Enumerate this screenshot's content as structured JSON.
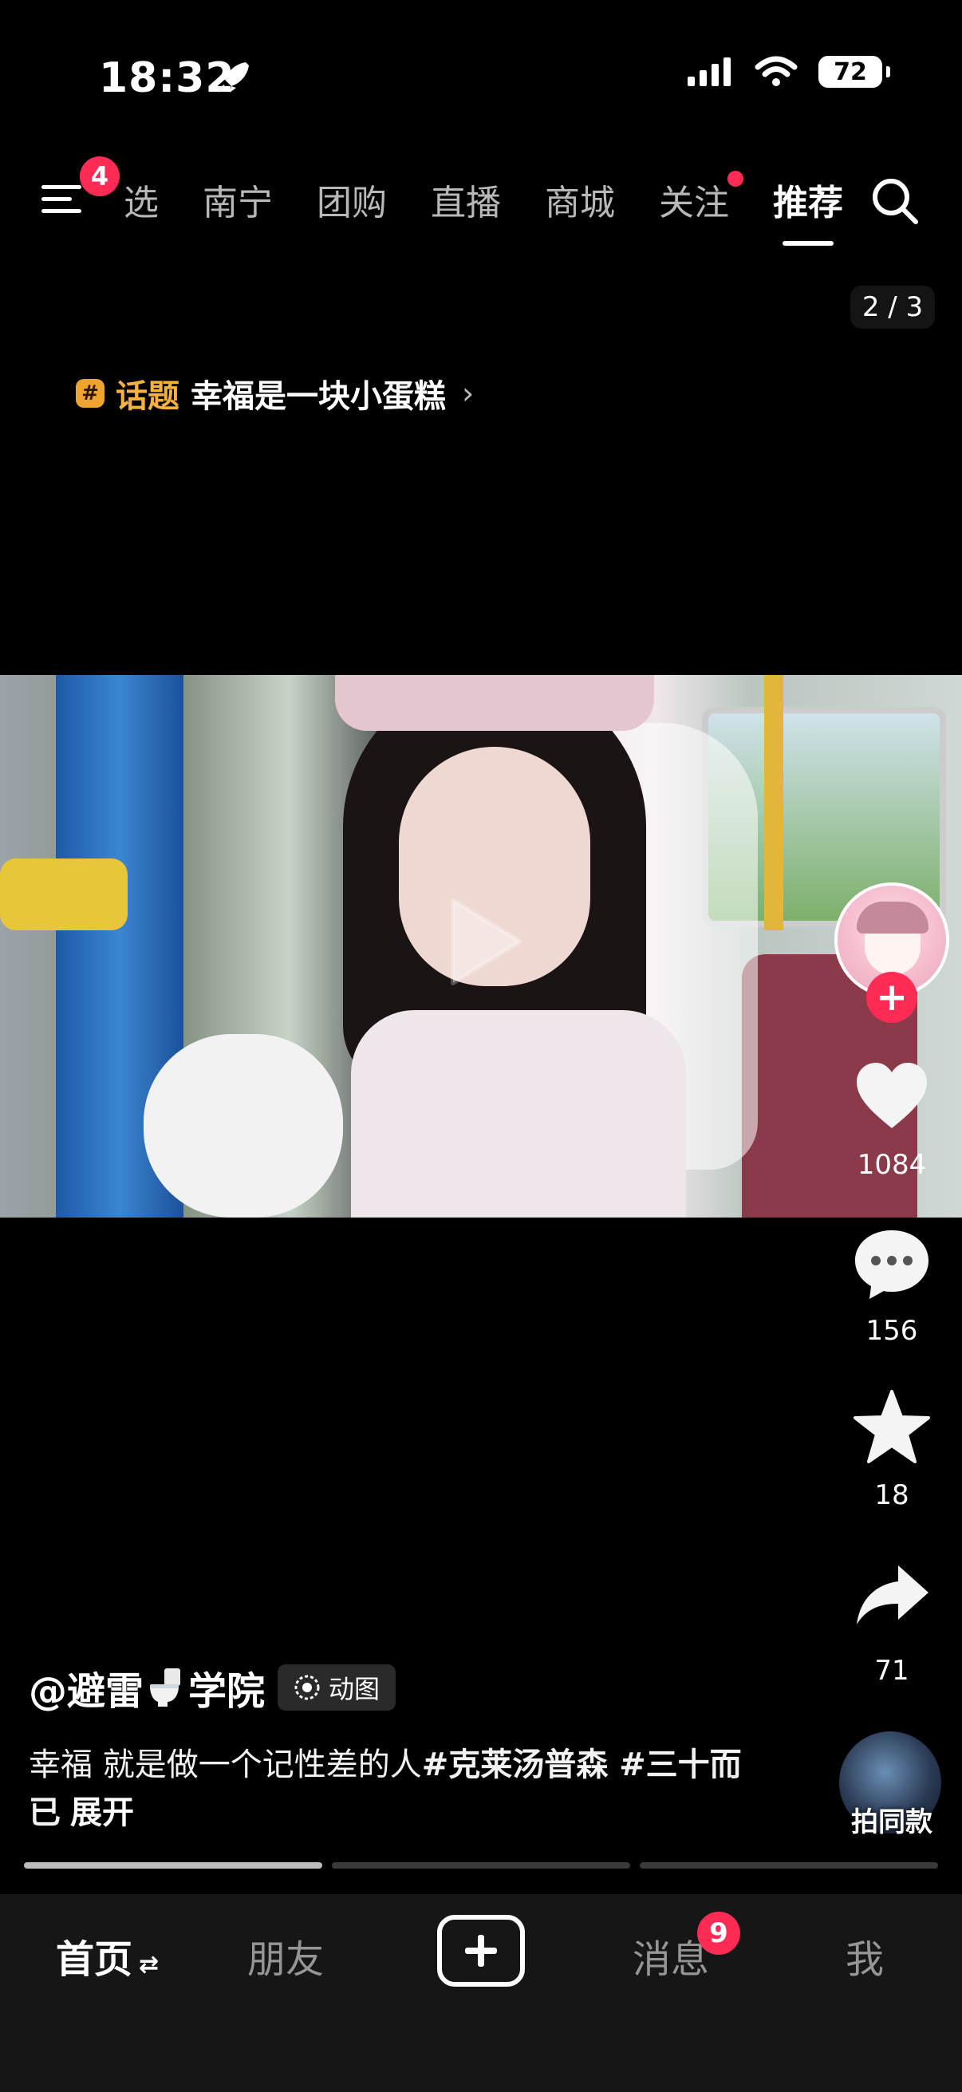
{
  "status_bar": {
    "time": "18:32",
    "battery": "72",
    "icons": [
      "rocket-icon",
      "signal-icon",
      "wifi-icon",
      "battery-icon"
    ]
  },
  "top_nav": {
    "menu_badge": "4",
    "tabs": [
      {
        "label": "选",
        "active": false
      },
      {
        "label": "南宁",
        "active": false
      },
      {
        "label": "团购",
        "active": false
      },
      {
        "label": "直播",
        "active": false
      },
      {
        "label": "商城",
        "active": false
      },
      {
        "label": "关注",
        "active": false,
        "dot": true
      },
      {
        "label": "推荐",
        "active": true
      }
    ]
  },
  "pager": "2 / 3",
  "topic": {
    "icon": "#",
    "label": "话题",
    "name": "幸福是一块小蛋糕"
  },
  "rail": {
    "likes": "1084",
    "comments": "156",
    "favorites": "18",
    "shares": "71",
    "same_style": "拍同款"
  },
  "post": {
    "author_prefix": "@避雷",
    "author_suffix": "学院",
    "badge": "动图",
    "caption_text": "幸福 就是做一个记性差的人",
    "hashtag1": "#克莱汤普森",
    "hashtag2": " #三十而已",
    "expand": "展开"
  },
  "progress": {
    "segments": 3,
    "current_fill": 1.0,
    "current_index": 0
  },
  "bottom_nav": {
    "home": "首页",
    "friends": "朋友",
    "messages": "消息",
    "messages_badge": "9",
    "me": "我"
  },
  "colors": {
    "accent": "#fe2c55",
    "topic": "#f5b33e",
    "background": "#000000"
  }
}
